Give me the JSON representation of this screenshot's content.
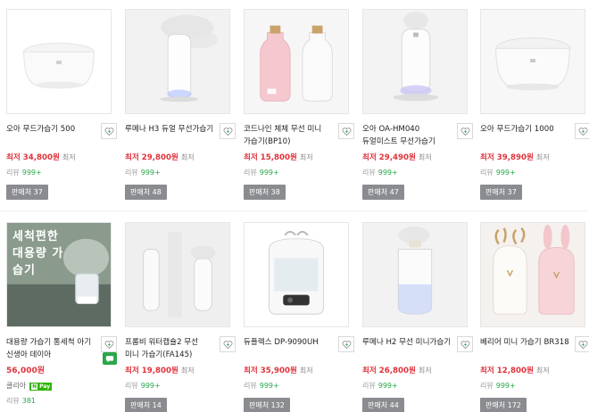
{
  "products": [
    {
      "title": "오아 무드가습기 500",
      "price": "최저 34,800원",
      "lowest": "최저",
      "review_label": "리뷰",
      "review_count": "999+",
      "sellers": "판매처 37"
    },
    {
      "title": "루메나 H3 듀얼 무선가습기",
      "price": "최저 29,800원",
      "lowest": "최저",
      "review_label": "리뷰",
      "review_count": "999+",
      "sellers": "판매처 48"
    },
    {
      "title": "코드나인 체체 무선 미니 가습기(BP10)",
      "price": "최저 15,800원",
      "lowest": "최저",
      "review_label": "리뷰",
      "review_count": "999+",
      "sellers": "판매처 38"
    },
    {
      "title": "오아 OA-HM040 듀얼미스트 무선가습기",
      "price": "최저 29,490원",
      "lowest": "최저",
      "review_label": "리뷰",
      "review_count": "999+",
      "sellers": "판매처 47"
    },
    {
      "title": "오아 무드가습기 1000",
      "price": "최저 39,890원",
      "lowest": "최저",
      "review_label": "리뷰",
      "review_count": "999+",
      "sellers": "판매처 37"
    },
    {
      "title": "대용량 가습기 통세척 아기 신생아 데이아",
      "price": "56,000원",
      "store": "클리아",
      "npay": "Pay",
      "npay_n": "N",
      "review_label": "리뷰",
      "review_count": "381",
      "banner": "세척편한 대용량 가습기"
    },
    {
      "title": "프롬비 워터캡슐2 무선 미니 가습기(FA145)",
      "price": "최저 19,800원",
      "lowest": "최저",
      "review_label": "리뷰",
      "review_count": "999+",
      "sellers": "판매처 14"
    },
    {
      "title": "듀플렉스 DP-9090UH",
      "price": "최저 35,900원",
      "lowest": "최저",
      "review_label": "리뷰",
      "review_count": "999+",
      "sellers": "판매처 132"
    },
    {
      "title": "루메나 H2 무선 미니가습기",
      "price": "최저 26,800원",
      "lowest": "최저",
      "review_label": "리뷰",
      "review_count": "999+",
      "sellers": "판매처 44"
    },
    {
      "title": "베리어 미니 가습기 BR318",
      "price": "최저 12,800원",
      "lowest": "최저",
      "review_label": "리뷰",
      "review_count": "999+",
      "sellers": "판매처 172"
    }
  ],
  "colors": {
    "price_red": "#e0323a",
    "review_green": "#2aa64b",
    "seller_button": "#8a8c90",
    "npay_green": "#2db400"
  },
  "icons": {
    "wish": "heart-plus-icon",
    "talk": "talktalk-chat-icon"
  }
}
